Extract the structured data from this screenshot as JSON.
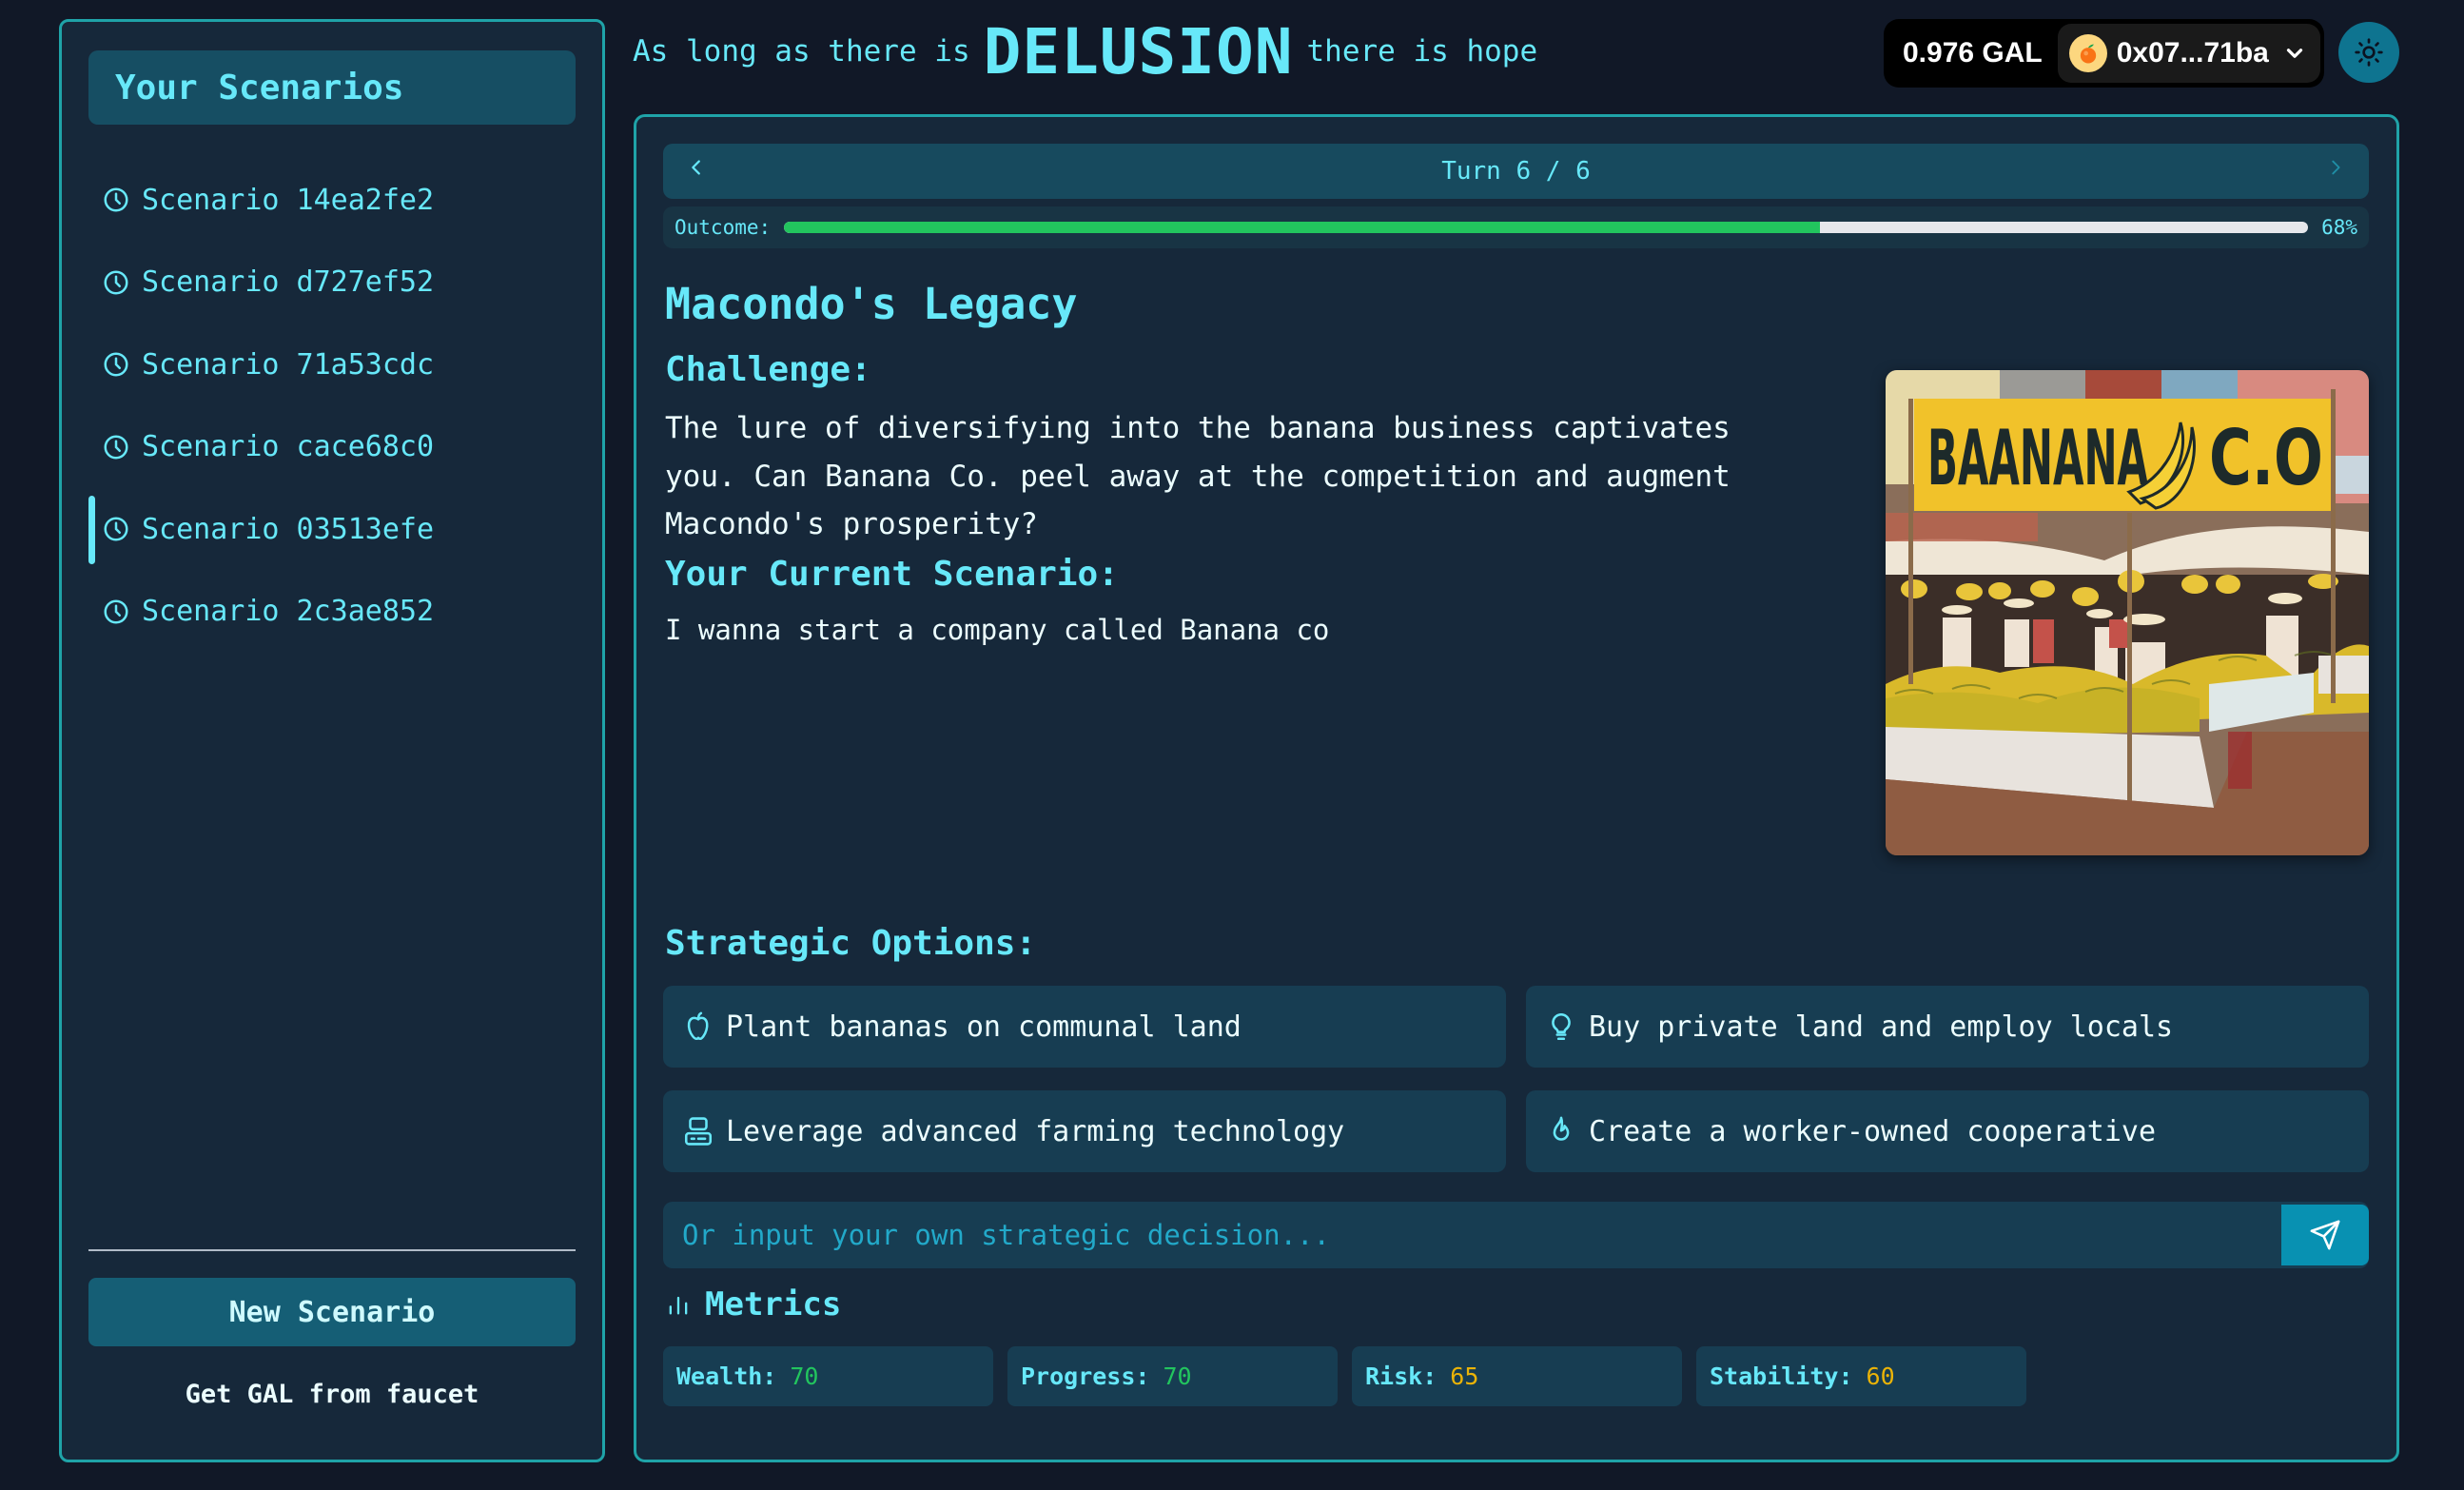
{
  "sidebar": {
    "title": "Your Scenarios",
    "items": [
      {
        "label": "Scenario 14ea2fe2",
        "active": false
      },
      {
        "label": "Scenario d727ef52",
        "active": false
      },
      {
        "label": "Scenario 71a53cdc",
        "active": false
      },
      {
        "label": "Scenario cace68c0",
        "active": false
      },
      {
        "label": "Scenario 03513efe",
        "active": true
      },
      {
        "label": "Scenario 2c3ae852",
        "active": false
      }
    ],
    "new_scenario_label": "New Scenario",
    "faucet_label": "Get GAL from faucet"
  },
  "header": {
    "tagline_prefix": "As long as there is",
    "tagline_emphasis": "DELUSION",
    "tagline_suffix": "there is hope",
    "wallet": {
      "balance": "0.976 GAL",
      "address": "0x07...71ba",
      "avatar_icon": "orange-icon"
    },
    "theme_toggle_icon": "sun-icon"
  },
  "main": {
    "turn_label": "Turn 6 / 6",
    "turn_current": 6,
    "turn_total": 6,
    "outcome_label": "Outcome:",
    "outcome_percent": 68,
    "outcome_percent_text": "68%",
    "title": "Macondo's Legacy",
    "challenge_heading": "Challenge:",
    "challenge_text": "The lure of diversifying into the banana business captivates you. Can Banana Co. peel away at the competition and augment Macondo's prosperity?",
    "current_heading": "Your Current Scenario:",
    "current_text": "I wanna start a company called Banana co",
    "image": {
      "alt": "Banana market stall with sign",
      "sign_text": "BAANANA C.O"
    },
    "options_heading": "Strategic Options:",
    "options": [
      {
        "label": "Plant bananas on communal land",
        "icon": "apple-icon"
      },
      {
        "label": "Buy private land and employ locals",
        "icon": "lightbulb-icon"
      },
      {
        "label": "Leverage advanced farming technology",
        "icon": "server-icon"
      },
      {
        "label": "Create a worker-owned cooperative",
        "icon": "flame-icon"
      }
    ],
    "decision_placeholder": "Or input your own strategic decision...",
    "decision_value": "",
    "metrics_heading": "Metrics",
    "metrics": [
      {
        "label": "Wealth:",
        "value": "70",
        "tone": "good"
      },
      {
        "label": "Progress:",
        "value": "70",
        "tone": "good"
      },
      {
        "label": "Risk:",
        "value": "65",
        "tone": "warn"
      },
      {
        "label": "Stability:",
        "value": "60",
        "tone": "warn"
      }
    ]
  },
  "colors": {
    "accent": "#67e8f9",
    "border": "#1fa3a8",
    "progress_fill": "#22c55e",
    "good": "#22c55e",
    "warn": "#eab308"
  }
}
